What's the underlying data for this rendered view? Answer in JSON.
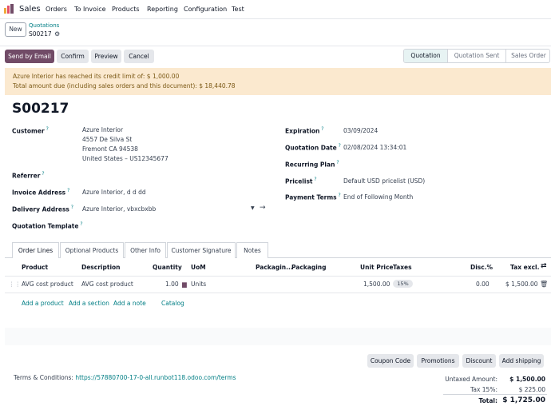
{
  "nav": {
    "app": "Sales",
    "items": [
      "Orders",
      "To Invoice",
      "Products",
      "Reporting",
      "Configuration",
      "Test"
    ]
  },
  "control_panel": {
    "new_label": "New",
    "breadcrumb": "Quotations",
    "record": "S00217"
  },
  "actions": {
    "send_email": "Send by Email",
    "confirm": "Confirm",
    "preview": "Preview",
    "cancel": "Cancel"
  },
  "status": {
    "stages": [
      "Quotation",
      "Quotation Sent",
      "Sales Order"
    ],
    "active": "Quotation"
  },
  "warning": {
    "line1": "Azure Interior has reached its credit limit of: $ 1,000.00",
    "line2": "Total amount due (including sales orders and this document): $ 18,440.78"
  },
  "form": {
    "title": "S00217",
    "customer_label": "Customer",
    "customer_name": "Azure Interior",
    "customer_addr1": "4557 De Silva St",
    "customer_addr2": "Fremont CA 94538",
    "customer_addr3": "United States – US12345677",
    "referrer_label": "Referrer",
    "invoice_label": "Invoice Address",
    "invoice_value": "Azure Interior, d d dd",
    "delivery_label": "Delivery Address",
    "delivery_value": "Azure Interior, vbxcbxbb",
    "template_label": "Quotation Template",
    "expiration_label": "Expiration",
    "expiration_value": "03/09/2024",
    "date_label": "Quotation Date",
    "date_value": "02/08/2024 13:34:01",
    "recurring_label": "Recurring Plan",
    "pricelist_label": "Pricelist",
    "pricelist_value": "Default USD pricelist (USD)",
    "terms_label": "Payment Terms",
    "terms_value": "End of Following Month"
  },
  "tabs": [
    "Order Lines",
    "Optional Products",
    "Other Info",
    "Customer Signature",
    "Notes"
  ],
  "table": {
    "headers": {
      "product": "Product",
      "description": "Description",
      "quantity": "Quantity",
      "uom": "UoM",
      "packaging_qty": "Packagin...",
      "packaging": "Packaging",
      "unit_price": "Unit Price",
      "taxes": "Taxes",
      "disc": "Disc.%",
      "tax_excl": "Tax excl."
    },
    "row": {
      "product": "AVG cost product",
      "description": "AVG cost product",
      "quantity": "1.00",
      "uom": "Units",
      "unit_price": "1,500.00",
      "tax": "15%",
      "disc": "0.00",
      "subtotal": "$ 1,500.00"
    },
    "links": [
      "Add a product",
      "Add a section",
      "Add a note",
      "Catalog"
    ]
  },
  "footer_buttons": [
    "Coupon Code",
    "Promotions",
    "Discount",
    "Add shipping"
  ],
  "terms": {
    "label": "Terms & Conditions: ",
    "url": "https://57880700-17-0-all.runbot118.odoo.com/terms"
  },
  "totals": {
    "untaxed_label": "Untaxed Amount:",
    "untaxed_value": "$ 1,500.00",
    "tax_label": "Tax 15%:",
    "tax_value": "$ 225.00",
    "total_label": "Total:",
    "total_value": "$ 1,725.00"
  },
  "colors": {
    "brand": "#714b67",
    "link": "#017e84",
    "warning_bg": "#fbe9cf"
  }
}
